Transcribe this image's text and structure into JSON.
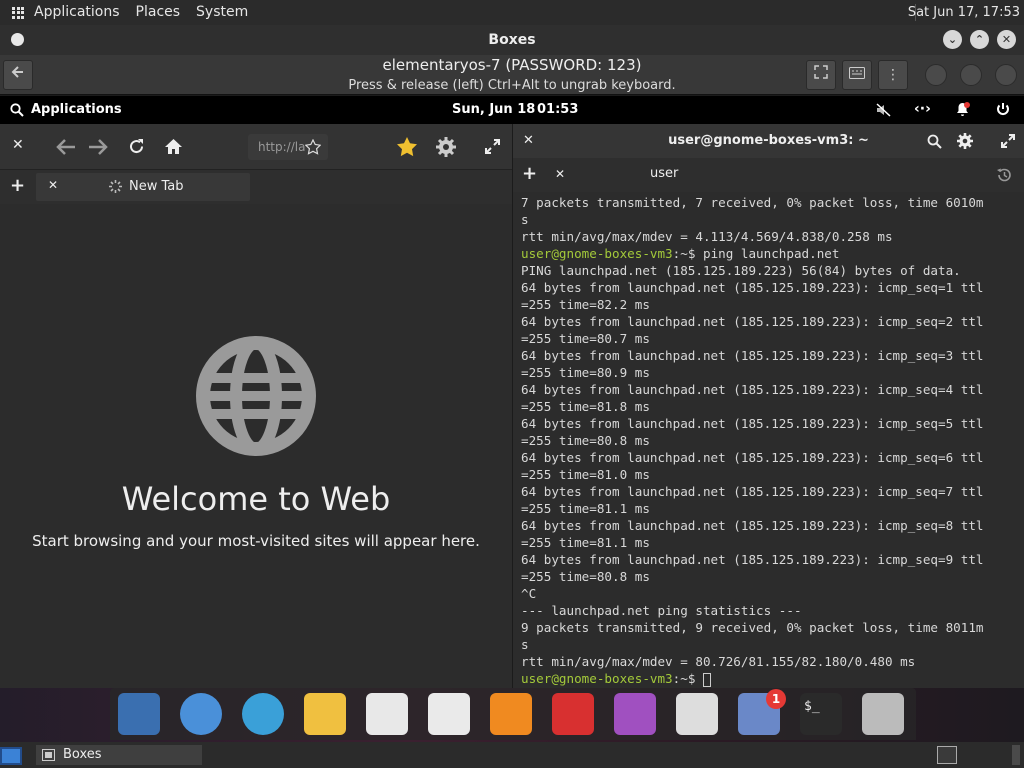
{
  "host_panel": {
    "menus": [
      "Applications",
      "Places",
      "System"
    ],
    "clock": "Sat Jun 17, 17:53"
  },
  "boxes": {
    "window_title": "Boxes",
    "vm_name": "elementaryos-7 (PASSWORD: 123)",
    "hint": "Press & release (left) Ctrl+Alt to ungrab keyboard."
  },
  "guest_panel": {
    "applications": "Applications",
    "date": "Sun, Jun 18",
    "time": "01:53"
  },
  "web": {
    "url_placeholder": "http://la",
    "tab_label": "New Tab",
    "welcome": "Welcome to Web",
    "subtitle": "Start browsing and your most-visited sites will appear here."
  },
  "terminal": {
    "title": "user@gnome-boxes-vm3: ~",
    "tab_label": "user",
    "lines": [
      {
        "t": "7 packets transmitted, 7 received, 0% packet loss, time 6010m"
      },
      {
        "t": "s"
      },
      {
        "t": "rtt min/avg/max/mdev = 4.113/4.569/4.838/0.258 ms"
      },
      {
        "p": "user@gnome-boxes-vm3",
        "t": ":~$ ping launchpad.net"
      },
      {
        "t": "PING launchpad.net (185.125.189.223) 56(84) bytes of data."
      },
      {
        "t": "64 bytes from launchpad.net (185.125.189.223): icmp_seq=1 ttl"
      },
      {
        "t": "=255 time=82.2 ms"
      },
      {
        "t": "64 bytes from launchpad.net (185.125.189.223): icmp_seq=2 ttl"
      },
      {
        "t": "=255 time=80.7 ms"
      },
      {
        "t": "64 bytes from launchpad.net (185.125.189.223): icmp_seq=3 ttl"
      },
      {
        "t": "=255 time=80.9 ms"
      },
      {
        "t": "64 bytes from launchpad.net (185.125.189.223): icmp_seq=4 ttl"
      },
      {
        "t": "=255 time=81.8 ms"
      },
      {
        "t": "64 bytes from launchpad.net (185.125.189.223): icmp_seq=5 ttl"
      },
      {
        "t": "=255 time=80.8 ms"
      },
      {
        "t": "64 bytes from launchpad.net (185.125.189.223): icmp_seq=6 ttl"
      },
      {
        "t": "=255 time=81.0 ms"
      },
      {
        "t": "64 bytes from launchpad.net (185.125.189.223): icmp_seq=7 ttl"
      },
      {
        "t": "=255 time=81.1 ms"
      },
      {
        "t": "64 bytes from launchpad.net (185.125.189.223): icmp_seq=8 ttl"
      },
      {
        "t": "=255 time=81.1 ms"
      },
      {
        "t": "64 bytes from launchpad.net (185.125.189.223): icmp_seq=9 ttl"
      },
      {
        "t": "=255 time=80.8 ms"
      },
      {
        "t": "^C"
      },
      {
        "t": "--- launchpad.net ping statistics ---"
      },
      {
        "t": "9 packets transmitted, 9 received, 0% packet loss, time 8011m"
      },
      {
        "t": "s"
      },
      {
        "t": "rtt min/avg/max/mdev = 80.726/81.155/82.180/0.480 ms"
      },
      {
        "p": "user@gnome-boxes-vm3",
        "t": ":~$ ",
        "cursor": true
      }
    ]
  },
  "dock": {
    "items": [
      {
        "name": "multitasking-view-icon",
        "color": "#3a6fb0"
      },
      {
        "name": "files-icon",
        "color": "#4a90d9"
      },
      {
        "name": "web-browser-icon",
        "color": "#3aa0d8"
      },
      {
        "name": "mail-icon",
        "color": "#f0c040"
      },
      {
        "name": "tasks-icon",
        "color": "#e8e8e8"
      },
      {
        "name": "calendar-icon",
        "color": "#eaeaea"
      },
      {
        "name": "music-icon",
        "color": "#f08a20"
      },
      {
        "name": "videos-icon",
        "color": "#d83030"
      },
      {
        "name": "photos-icon",
        "color": "#a050c0"
      },
      {
        "name": "settings-icon",
        "color": "#dddddd"
      },
      {
        "name": "appcenter-icon",
        "color": "#6a88c8",
        "badge": "1"
      },
      {
        "name": "terminal-icon",
        "color": "#2a2a2a"
      },
      {
        "name": "trash-icon",
        "color": "#bbbbbb"
      }
    ]
  },
  "taskbar": {
    "window_button": "Boxes"
  }
}
